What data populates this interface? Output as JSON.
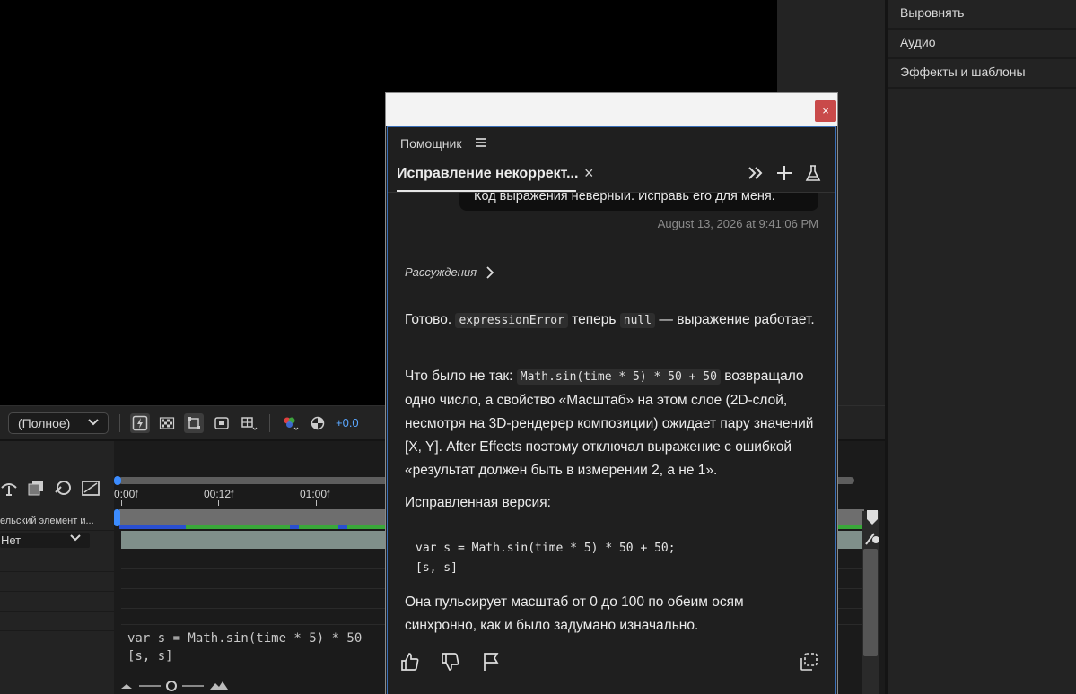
{
  "right_panel": {
    "items": [
      "Выровнять",
      "Аудио",
      "Эффекты и шаблоны"
    ]
  },
  "viewer_toolbar": {
    "resolution": "(Полное)",
    "exposure": "+0.0"
  },
  "timeline": {
    "row_parent": "ельский элемент и...",
    "parent_select": "Нет",
    "ticks": [
      "0:00f",
      "00:12f",
      "01:00f"
    ],
    "expression_lines": [
      "var s = Math.sin(time * 5) * 50",
      "[s, s]"
    ]
  },
  "assistant": {
    "close_label": "×",
    "panel_title": "Помощник",
    "tab_title": "Исправление некоррект...",
    "tab_close": "×",
    "user_message": "Код выражения неверный. Исправь его для меня.",
    "timestamp": "August 13, 2026 at 9:41:06 PM",
    "reasoning_label": "Рассуждения",
    "msg1": {
      "t1": "Готово. ",
      "c1": "expressionError",
      "t2": " теперь ",
      "c2": "null",
      "t3": " — выражение работает."
    },
    "msg2": {
      "t1": "Что было не так: ",
      "c1": "Math.sin(time * 5) * 50 + 50",
      "t2": " возвращало одно число, а свойство «Масштаб» на этом слое (2D-слой, несмотря на 3D-рендерер композиции) ожидает пару значений [X, Y]. After Effects поэтому отключал выражение с ошибкой «результат должен быть в измерении 2, а не 1»."
    },
    "msg3": "Исправленная версия:",
    "code_lines": [
      "var s = Math.sin(time * 5) * 50 + 50;",
      "[s, s]"
    ],
    "msg4": "Она пульсирует масштаб от 0 до 100 по обеим осям синхронно, как и было задумано изначально."
  }
}
